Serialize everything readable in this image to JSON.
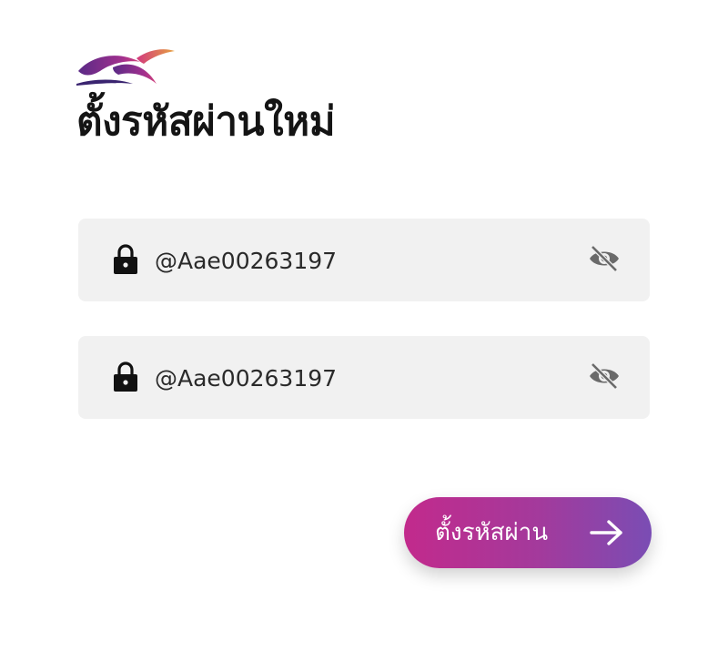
{
  "page": {
    "title": "ตั้งรหัสผ่านใหม่"
  },
  "logo": {
    "icon": "bird-wing-logo",
    "colors": [
      "#6a2a8c",
      "#c2306c",
      "#e8b040"
    ]
  },
  "form": {
    "new_password": {
      "value": "@Aae00263197",
      "lock_icon": "lock-icon",
      "toggle_icon": "eye-off-icon"
    },
    "confirm_password": {
      "value": "@Aae00263197",
      "lock_icon": "lock-icon",
      "toggle_icon": "eye-off-icon"
    },
    "submit": {
      "label": "ตั้งรหัสผ่าน",
      "icon": "arrow-right-icon",
      "gradient": [
        "#c22a8c",
        "#7a4db4"
      ]
    }
  },
  "colors": {
    "field_background": "#f1f1f1",
    "text": "#141414"
  }
}
